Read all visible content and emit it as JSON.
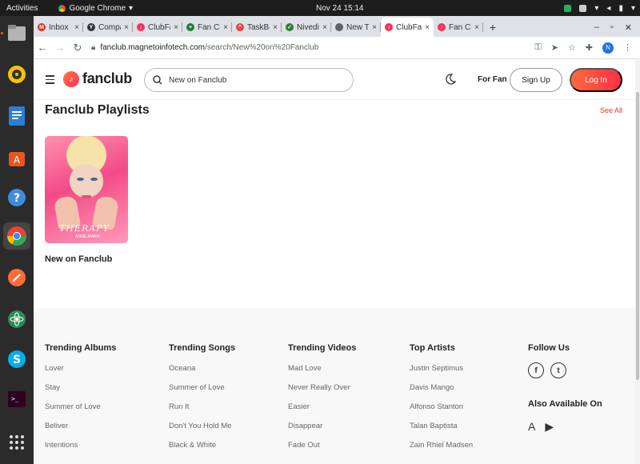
{
  "system": {
    "activities": "Activities",
    "app_name": "Google Chrome",
    "clock": "Nov 24  15:14"
  },
  "browser": {
    "tabs": [
      {
        "title": "Inbox -",
        "fav": "M",
        "color": "#d93025"
      },
      {
        "title": "Compa",
        "fav": "Y",
        "color": "#333333"
      },
      {
        "title": "ClubFa",
        "fav": "♪",
        "color": "#ff2d55"
      },
      {
        "title": "Fan Clu",
        "fav": "+",
        "color": "#188038"
      },
      {
        "title": "TaskBo",
        "fav": "^",
        "color": "#e8453c"
      },
      {
        "title": "Nivedit",
        "fav": "✓",
        "color": "#2e7d32"
      },
      {
        "title": "New Ta",
        "fav": "",
        "color": "#5f6368"
      },
      {
        "title": "ClubFa",
        "fav": "♪",
        "color": "#ff2d55",
        "active": true
      },
      {
        "title": "Fan Clu",
        "fav": "♪",
        "color": "#ff2d55"
      }
    ],
    "url_host": "fanclub.magnetoinfotech.com",
    "url_path": "/search/New%20on%20Fanclub",
    "profile_initial": "N"
  },
  "site": {
    "logo": "fanclub",
    "search_value": "New on Fanclub",
    "for_fan": "For Fan",
    "sign_up": "Sign Up",
    "log_in": "Log In",
    "accent": "#ff3d4a"
  },
  "playlists": {
    "title": "Fanclub Playlists",
    "see_all": "See All",
    "items": [
      {
        "name": "New on Fanclub",
        "cover_title": "THERAPY",
        "cover_artist": "ANNE-MARIE"
      }
    ]
  },
  "footer": {
    "columns": [
      {
        "title": "Trending Albums",
        "items": [
          "Lover",
          "Stay",
          "Summer of Love",
          "Beliver",
          "Intentions"
        ]
      },
      {
        "title": "Trending Songs",
        "items": [
          "Oceana",
          "Summer of Love",
          "Run It",
          "Don't You Hold Me",
          "Black & White"
        ]
      },
      {
        "title": "Trending Videos",
        "items": [
          "Mad Love",
          "Never Really Over",
          "Easier",
          "Disappear",
          "Fade Out"
        ]
      },
      {
        "title": "Top Artists",
        "items": [
          "Justin Septimus",
          "Davis Mango",
          "Alfonso Stanton",
          "Talan Baptista",
          "Zain Rhiel Madsen"
        ]
      }
    ],
    "follow_us": "Follow Us",
    "also_available": "Also Available On"
  }
}
